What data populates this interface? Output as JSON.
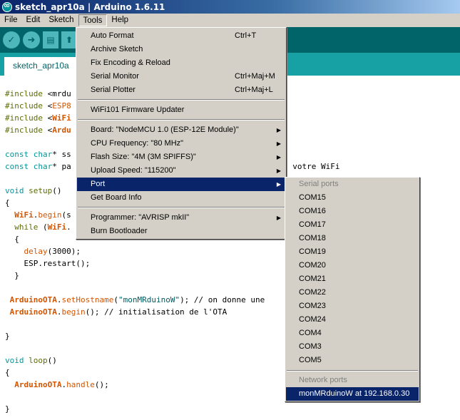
{
  "window": {
    "title": "sketch_apr10a | Arduino 1.6.11"
  },
  "menubar": [
    "File",
    "Edit",
    "Sketch",
    "Tools",
    "Help"
  ],
  "toolbar": {
    "verify_icon": "check-icon",
    "upload_icon": "arrow-right-icon",
    "new_icon": "new-file-icon",
    "open_icon": "open-icon"
  },
  "tab": {
    "label": "sketch_apr10a"
  },
  "code": [
    "#include <mrdu",
    "#include <ESP8",
    "#include <WiFi",
    "#include <Ardu",
    "",
    "const char* ss",
    "const char* pa",
    "",
    "void setup()",
    "{",
    "  WiFi.begin(s",
    "  while (WiFi.",
    "  {",
    "    delay(3000);",
    "    ESP.restart();",
    "  }",
    "",
    " ArduinoOTA.setHostname(\"monMRduinoW\"); // on donne une",
    " ArduinoOTA.begin(); // initialisation de l'OTA",
    "",
    "}",
    "",
    "void loop()",
    "{",
    "  ArduinoOTA.handle();",
    "",
    "}"
  ],
  "code_tail": {
    "line6": ": votre WiFi"
  },
  "tools_menu": {
    "group1": [
      {
        "label": "Auto Format",
        "shortcut": "Ctrl+T"
      },
      {
        "label": "Archive Sketch",
        "shortcut": ""
      },
      {
        "label": "Fix Encoding & Reload",
        "shortcut": ""
      },
      {
        "label": "Serial Monitor",
        "shortcut": "Ctrl+Maj+M"
      },
      {
        "label": "Serial Plotter",
        "shortcut": "Ctrl+Maj+L"
      }
    ],
    "group2": [
      {
        "label": "WiFi101 Firmware Updater"
      }
    ],
    "group3": [
      {
        "label": "Board: \"NodeMCU 1.0 (ESP-12E Module)\""
      },
      {
        "label": "CPU Frequency: \"80 MHz\""
      },
      {
        "label": "Flash Size: \"4M (3M SPIFFS)\""
      },
      {
        "label": "Upload Speed: \"115200\""
      },
      {
        "label": "Port"
      },
      {
        "label": "Get Board Info"
      }
    ],
    "group4": [
      {
        "label": "Programmer: \"AVRISP mkII\""
      },
      {
        "label": "Burn Bootloader"
      }
    ]
  },
  "port_menu": {
    "serial_header": "Serial ports",
    "serial_ports": [
      "COM15",
      "COM16",
      "COM17",
      "COM18",
      "COM19",
      "COM20",
      "COM21",
      "COM22",
      "COM23",
      "COM24",
      "COM4",
      "COM3",
      "COM5"
    ],
    "network_header": "Network ports",
    "network_ports": [
      "monMRduinoW at 192.168.0.30"
    ]
  },
  "colors": {
    "teal_dark": "#006468",
    "teal_light": "#17a1a5",
    "highlight": "#0a246a",
    "menu_bg": "#d4d0c8"
  }
}
